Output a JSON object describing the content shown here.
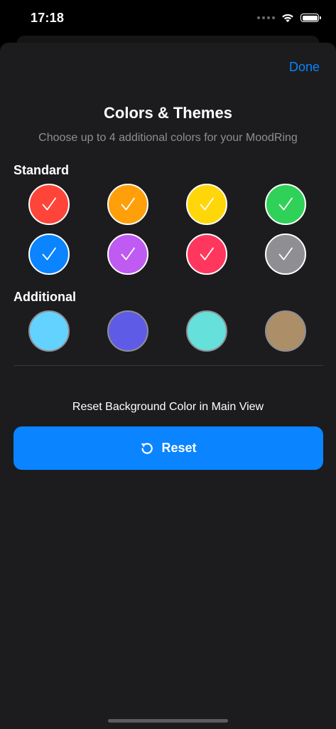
{
  "status_bar": {
    "time": "17:18",
    "wifi_icon": "wifi-icon",
    "battery_icon": "battery-icon",
    "battery_level": 1.0
  },
  "sheet": {
    "done_label": "Done",
    "title": "Colors & Themes",
    "subtitle": "Choose up to 4 additional colors for your MoodRing"
  },
  "sections": {
    "standard_label": "Standard",
    "additional_label": "Additional"
  },
  "standard_colors": [
    {
      "id": "red",
      "color": "#ff453a",
      "selected": true
    },
    {
      "id": "orange",
      "color": "#ff9f0a",
      "selected": true
    },
    {
      "id": "yellow",
      "color": "#ffd60a",
      "selected": true
    },
    {
      "id": "green",
      "color": "#30d158",
      "selected": true
    },
    {
      "id": "blue",
      "color": "#0a84ff",
      "selected": true
    },
    {
      "id": "purple",
      "color": "#bf5af2",
      "selected": true
    },
    {
      "id": "pink",
      "color": "#ff375f",
      "selected": true
    },
    {
      "id": "gray",
      "color": "#8e8e93",
      "selected": true
    }
  ],
  "additional_colors": [
    {
      "id": "light-blue",
      "color": "#64d2ff",
      "selected": false
    },
    {
      "id": "indigo",
      "color": "#5e5ce6",
      "selected": false
    },
    {
      "id": "teal",
      "color": "#66e0da",
      "selected": false
    },
    {
      "id": "brown",
      "color": "#ac8e68",
      "selected": false
    }
  ],
  "reset": {
    "caption": "Reset Background Color in Main View",
    "button_label": "Reset",
    "icon": "reset-arrow-icon"
  },
  "colors": {
    "accent": "#0a84ff",
    "sheet_background": "#1c1c1e",
    "secondary_text": "#8e8e93"
  }
}
